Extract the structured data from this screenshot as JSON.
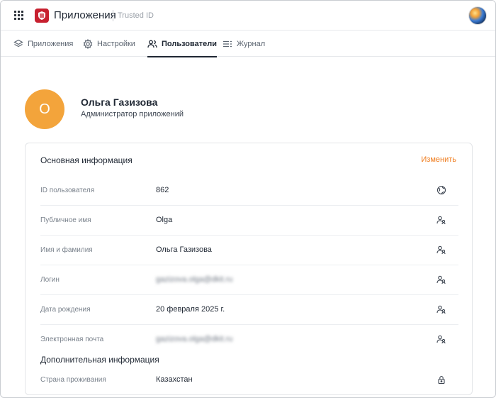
{
  "header": {
    "app_title": "Приложения",
    "app_subtitle": "Trusted ID",
    "logo_icon": "shield-logo-icon",
    "brand_color": "#c7202f"
  },
  "tabs": [
    {
      "label": "Приложения",
      "icon": "layers-icon",
      "active": false
    },
    {
      "label": "Настройки",
      "icon": "gear-icon",
      "active": false
    },
    {
      "label": "Пользователи",
      "icon": "users-icon",
      "active": true
    },
    {
      "label": "Журнал",
      "icon": "list-icon",
      "active": false
    }
  ],
  "profile": {
    "initial": "О",
    "name": "Ольга Газизова",
    "role": "Администратор приложений",
    "avatar_color": "#f3a43b"
  },
  "card": {
    "title": "Основная информация",
    "edit_label": "Изменить",
    "accent_color": "#ef7a1a",
    "rows": [
      {
        "label": "ID пользователя",
        "value": "862",
        "icon": "globe-icon"
      },
      {
        "label": "Публичное имя",
        "value": "Olga",
        "icon": "users-icon"
      },
      {
        "label": "Имя и фамилия",
        "value": "Ольга Газизова",
        "icon": "users-icon"
      },
      {
        "label": "Логин",
        "value": "gazizova.olga@dkit.ru",
        "icon": "users-icon",
        "blurred": true
      },
      {
        "label": "Дата рождения",
        "value": "20 февраля 2025 г.",
        "icon": "users-icon"
      },
      {
        "label": "Электронная почта",
        "value": "gazizova.olga@dkit.ru",
        "icon": "users-icon",
        "blurred": true
      }
    ],
    "extra_title": "Дополнительная информация",
    "extra_rows": [
      {
        "label": "Страна проживания",
        "value": "Казахстан",
        "icon": "lock-icon"
      }
    ]
  }
}
